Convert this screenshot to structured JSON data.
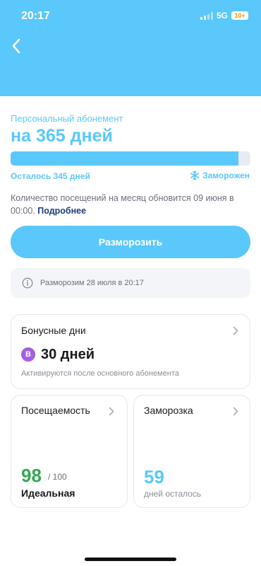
{
  "status_bar": {
    "time": "20:17",
    "network": "5G",
    "battery": "10+"
  },
  "header": {
    "back_icon": "chevron-left-icon",
    "color": "#5ac8fa"
  },
  "subscription": {
    "type": "Персональный абонемент",
    "title": "на 365 дней",
    "progress_fraction": 0.95,
    "remaining": "Осталось 345 дней",
    "status": "Заморожен",
    "status_icon": "snowflake-icon",
    "info": "Количество посещений на месяц обновится 09 июня в 00:00.",
    "more_link": "Подробнее"
  },
  "actions": {
    "unfreeze_label": "Разморозить"
  },
  "notice": {
    "icon": "info-icon",
    "text": "Разморозим 28 июля в 20:17"
  },
  "bonus": {
    "title": "Бонусные дни",
    "badge": "B",
    "value": "30 дней",
    "note": "Активируются после основного абонемента"
  },
  "attendance": {
    "title": "Посещаемость",
    "value": "98",
    "max": "/ 100",
    "label": "Идеальная"
  },
  "freeze": {
    "title": "Заморозка",
    "value": "59",
    "label": "дней осталось"
  },
  "colors": {
    "accent": "#5ac8fa",
    "good": "#34a853",
    "bonus_badge": "#a45ee6",
    "link": "#1f3c7a"
  }
}
